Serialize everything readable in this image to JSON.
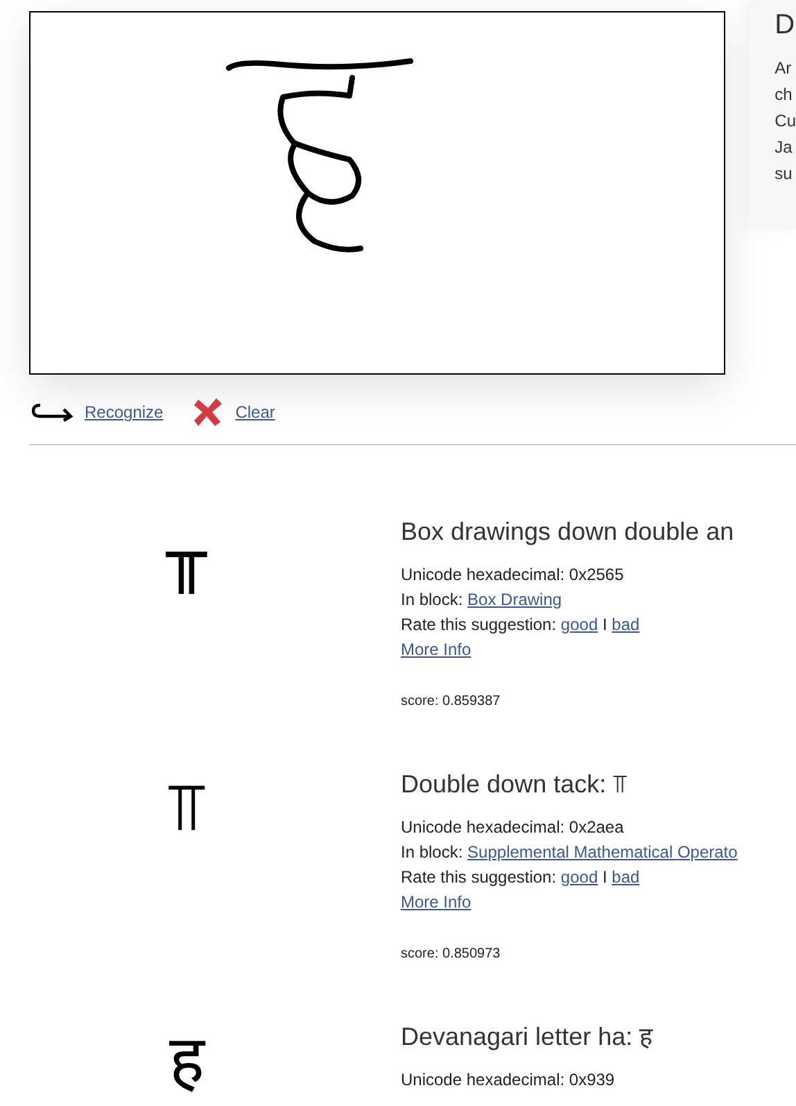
{
  "side_panel": {
    "heading": "D",
    "lines": [
      "Ar",
      "ch",
      "Cu",
      "Ja",
      "su"
    ]
  },
  "actions": [
    {
      "kind": "recognize",
      "label": "Recognize"
    },
    {
      "kind": "clear",
      "label": "Clear"
    }
  ],
  "results": [
    {
      "glyph": "╥",
      "title": "Box drawings down double an",
      "hex": "Unicode hexadecimal: 0x2565",
      "block_label": "In block:",
      "block": "Box Drawing",
      "rate_label": "Rate this suggestion:",
      "good": "good",
      "separator": "I",
      "bad": "bad",
      "more": "More Info",
      "score": "score: 0.859387"
    },
    {
      "glyph": "⫪",
      "title": "Double down tack: ⫪",
      "hex": "Unicode hexadecimal: 0x2aea",
      "block_label": "In block:",
      "block": "Supplemental Mathematical Operato",
      "rate_label": "Rate this suggestion:",
      "good": "good",
      "separator": "I",
      "bad": "bad",
      "more": "More Info",
      "score": "score: 0.850973"
    },
    {
      "glyph": "ह",
      "title": "Devanagari letter ha: ह",
      "hex": "Unicode hexadecimal: 0x939"
    }
  ]
}
